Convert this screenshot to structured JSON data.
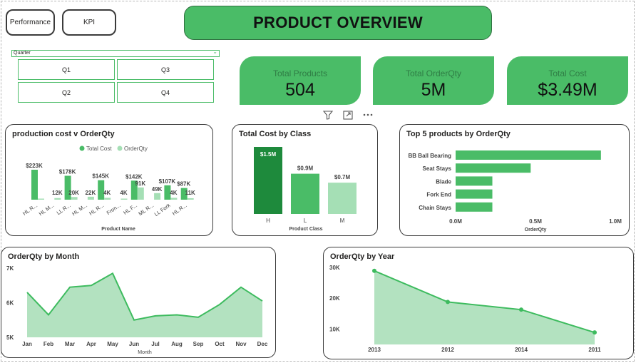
{
  "nav": {
    "performance": "Performance",
    "kpi": "KPI"
  },
  "header": {
    "title": "PRODUCT OVERVIEW"
  },
  "filter": {
    "label": "Quarter",
    "options": [
      "Q1",
      "Q3",
      "Q2",
      "Q4"
    ]
  },
  "kpis": [
    {
      "label": "Total Products",
      "value": "504"
    },
    {
      "label": "Total OrderQty",
      "value": "5M"
    },
    {
      "label": "Total Cost",
      "value": "$3.49M"
    }
  ],
  "toolbar_icons": [
    "filter-icon",
    "focus-mode-icon",
    "more-options-icon"
  ],
  "colors": {
    "accent": "#4abc67",
    "dark": "#1e8a3c",
    "light": "#a5dfb5",
    "line": "#3dbb5e",
    "area": "#b3e2c0"
  },
  "charts": {
    "cost_vs_qty": {
      "title": "production cost v OrderQty",
      "legend": [
        "Total Cost",
        "OrderQty"
      ],
      "xlabel": "Product Name",
      "chart_data": {
        "type": "bar",
        "categories": [
          "HL R...",
          "HL M...",
          "LL R...",
          "HL M...",
          "HL R...",
          "Fron...",
          "HL F...",
          "ML R...",
          "LL Fork",
          "HL R..."
        ],
        "series": [
          {
            "name": "Total Cost",
            "values": [
              223,
              0,
              178,
              0,
              145,
              0,
              142,
              0,
              107,
              87
            ],
            "labels": [
              "$223K",
              "",
              "$178K",
              "",
              "$145K",
              "",
              "$142K",
              "",
              "$107K",
              "$87K"
            ]
          },
          {
            "name": "OrderQty",
            "values": [
              2,
              12,
              20,
              22,
              14,
              4,
              91,
              49,
              14,
              11
            ],
            "labels": [
              "",
              "12K",
              "20K",
              "22K",
              "4K",
              "4K",
              "91K",
              "49K",
              "4K",
              "11K"
            ]
          }
        ],
        "units": "thousands"
      }
    },
    "cost_by_class": {
      "title": "Total Cost by Class",
      "xlabel": "Product Class",
      "chart_data": {
        "type": "bar",
        "categories": [
          "H",
          "L",
          "M"
        ],
        "values": [
          1.5,
          0.9,
          0.7
        ],
        "labels": [
          "$1.5M",
          "$0.9M",
          "$0.7M"
        ]
      }
    },
    "top5": {
      "title": "Top 5 products by OrderQty",
      "xlabel": "OrderQty",
      "chart_data": {
        "type": "bar",
        "orientation": "horizontal",
        "categories": [
          "BB Ball Bearing",
          "Seat Stays",
          "Blade",
          "Fork End",
          "Chain Stays"
        ],
        "values": [
          0.91,
          0.47,
          0.23,
          0.23,
          0.23
        ],
        "xticks": [
          "0.0M",
          "0.5M",
          "1.0M"
        ],
        "xlim": [
          0,
          1.0
        ]
      }
    },
    "by_month": {
      "title": "OrderQty by Month",
      "xlabel": "Month",
      "chart_data": {
        "type": "area",
        "categories": [
          "Jan",
          "Feb",
          "Mar",
          "Apr",
          "May",
          "Jun",
          "Jul",
          "Aug",
          "Sep",
          "Oct",
          "Nov",
          "Dec"
        ],
        "values": [
          6300,
          5650,
          6450,
          6500,
          6850,
          5500,
          5620,
          5650,
          5580,
          5950,
          6450,
          6050
        ],
        "yticks": [
          "7K",
          "6K",
          "5K"
        ],
        "ylim": [
          5000,
          7000
        ]
      }
    },
    "by_year": {
      "title": "OrderQty by Year",
      "chart_data": {
        "type": "area",
        "categories": [
          "2013",
          "2012",
          "2014",
          "2011"
        ],
        "values": [
          28900,
          18800,
          16300,
          8900
        ],
        "yticks": [
          "30K",
          "20K",
          "10K"
        ],
        "ylim": [
          5000,
          30000
        ]
      }
    }
  }
}
